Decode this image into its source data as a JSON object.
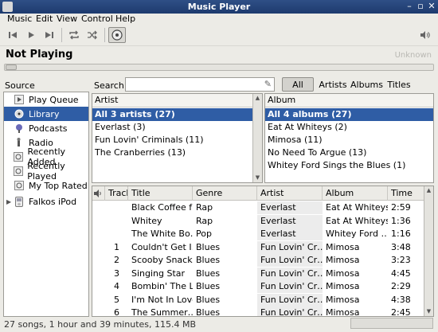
{
  "window": {
    "title": "Music Player"
  },
  "menu": [
    "Music",
    "Edit",
    "View",
    "Control",
    "Help"
  ],
  "now_playing": {
    "title": "Not Playing",
    "artist": "Unknown"
  },
  "source": {
    "header": "Source",
    "items": [
      {
        "label": "Play Queue",
        "icon": "play-queue-icon"
      },
      {
        "label": "Library",
        "icon": "library-icon",
        "selected": true
      },
      {
        "label": "Podcasts",
        "icon": "podcast-icon"
      },
      {
        "label": "Radio",
        "icon": "radio-icon"
      },
      {
        "label": "Recently Added",
        "icon": "playlist-icon"
      },
      {
        "label": "Recently Played",
        "icon": "playlist-icon"
      },
      {
        "label": "My Top Rated",
        "icon": "playlist-icon"
      },
      {
        "label": "Falkos iPod",
        "icon": "ipod-icon"
      }
    ]
  },
  "search": {
    "label": "Search:",
    "value": ""
  },
  "filters": [
    "All",
    "Artists",
    "Albums",
    "Titles"
  ],
  "artist_pane": {
    "header": "Artist",
    "rows": [
      "All 3 artists (27)",
      "Everlast (3)",
      "Fun Lovin' Criminals (11)",
      "The Cranberries (13)"
    ]
  },
  "album_pane": {
    "header": "Album",
    "rows": [
      "All 4 albums (27)",
      "Eat At Whiteys (2)",
      "Mimosa (11)",
      "No Need To Argue (13)",
      "Whitey Ford Sings the Blues (1)"
    ]
  },
  "tracks": {
    "columns": [
      "",
      "Track",
      "Title",
      "Genre",
      "Artist",
      "Album",
      "Time"
    ],
    "rows": [
      [
        "",
        "",
        "Black Coffee f…",
        "Rap",
        "Everlast",
        "Eat At Whiteys",
        "2:59"
      ],
      [
        "",
        "",
        "Whitey",
        "Rap",
        "Everlast",
        "Eat At Whiteys",
        "1:36"
      ],
      [
        "",
        "",
        "The White Bo…",
        "Pop",
        "Everlast",
        "Whitey Ford …",
        "1:16"
      ],
      [
        "",
        "1",
        "Couldn't Get I…",
        "Blues",
        "Fun Lovin' Cr…",
        "Mimosa",
        "3:48"
      ],
      [
        "",
        "2",
        "Scooby Snacks",
        "Blues",
        "Fun Lovin' Cr…",
        "Mimosa",
        "3:23"
      ],
      [
        "",
        "3",
        "Singing Star",
        "Blues",
        "Fun Lovin' Cr…",
        "Mimosa",
        "4:45"
      ],
      [
        "",
        "4",
        "Bombin' The L",
        "Blues",
        "Fun Lovin' Cr…",
        "Mimosa",
        "2:29"
      ],
      [
        "",
        "5",
        "I'm Not In Love",
        "Blues",
        "Fun Lovin' Cr…",
        "Mimosa",
        "4:38"
      ],
      [
        "",
        "6",
        "The Summer…",
        "Blues",
        "Fun Lovin' Cr…",
        "Mimosa",
        "2:45"
      ]
    ]
  },
  "status": "27 songs, 1 hour and 39 minutes, 115.4 MB"
}
